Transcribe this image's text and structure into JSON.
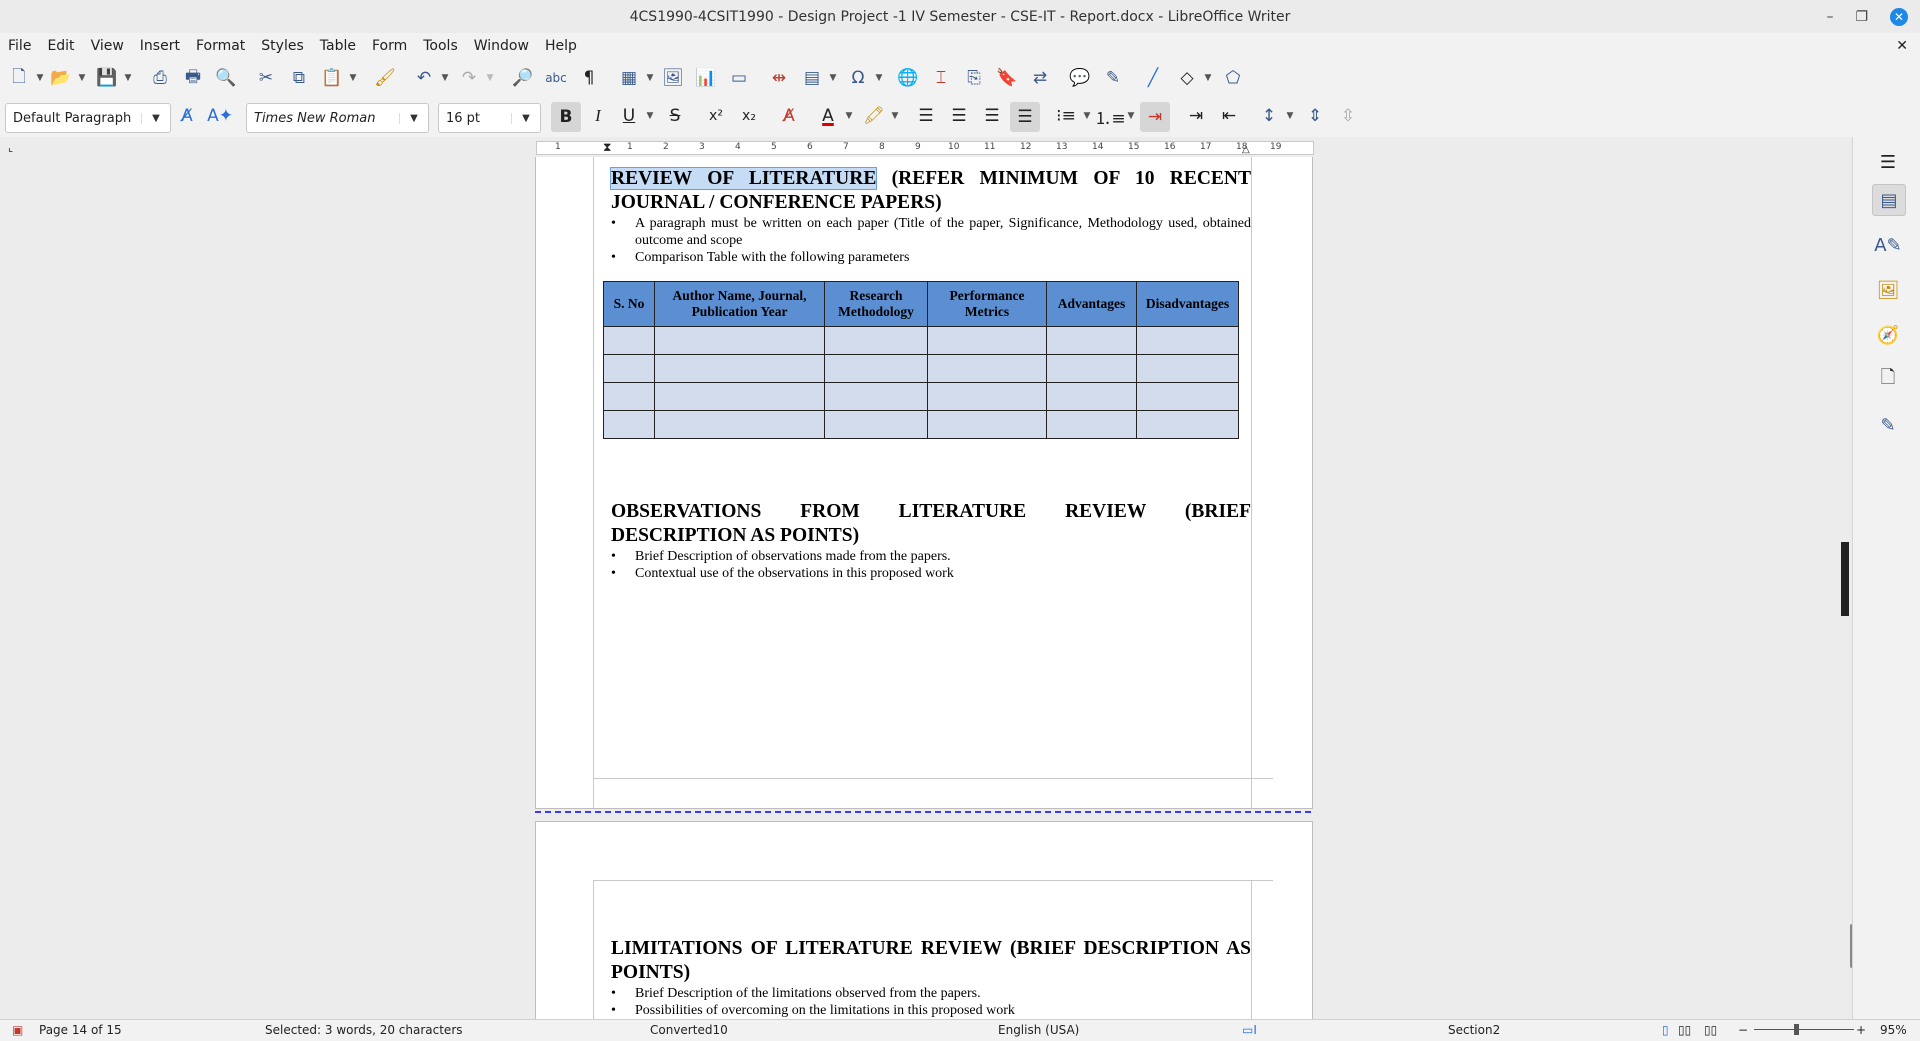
{
  "window": {
    "title": "4CS1990-4CSIT1990 - Design Project -1 IV Semester - CSE-IT - Report.docx - LibreOffice Writer"
  },
  "menu": [
    "File",
    "Edit",
    "View",
    "Insert",
    "Format",
    "Styles",
    "Table",
    "Form",
    "Tools",
    "Window",
    "Help"
  ],
  "formatting": {
    "paragraph_style": "Default Paragraph",
    "font_name": "Times New Roman",
    "font_size": "16 pt"
  },
  "ruler": {
    "numbers": [
      "1",
      "1",
      "2",
      "3",
      "4",
      "5",
      "6",
      "7",
      "8",
      "9",
      "10",
      "11",
      "12",
      "13",
      "14",
      "15",
      "16",
      "17",
      "18",
      "19"
    ]
  },
  "page1": {
    "heading_selected": "REVIEW OF LITERATURE",
    "heading_rest": " (REFER MINIMUM OF 10 RECENT JOURNAL / CONFERENCE PAPERS)",
    "bullets": [
      "A paragraph must be written on each paper (Title of the paper, Significance, Methodology used, obtained outcome and scope",
      "Comparison Table with the following parameters"
    ],
    "table": {
      "headers": [
        "S. No",
        "Author Name, Journal, Publication Year",
        "Research Methodology",
        "Performance Metrics",
        "Advantages",
        "Disadvantages"
      ],
      "empty_rows": 4
    },
    "heading2": "OBSERVATIONS FROM LITERATURE REVIEW (BRIEF DESCRIPTION AS POINTS)",
    "bullets2": [
      "Brief Description of observations made from the papers.",
      "Contextual use of the observations in this proposed work"
    ]
  },
  "page2": {
    "heading": "LIMITATIONS OF LITERATURE REVIEW (BRIEF DESCRIPTION AS POINTS)",
    "bullets": [
      "Brief Description of the limitations observed from the papers.",
      "Possibilities of overcoming on the limitations in this proposed work"
    ]
  },
  "status": {
    "page": "Page 14 of 15",
    "selection": "Selected: 3 words, 20 characters",
    "page_style": "Converted10",
    "language": "English (USA)",
    "section": "Section2",
    "zoom": "95%"
  },
  "colors": {
    "table_header": "#5b8fd2",
    "table_cell": "#d3dcec",
    "selection": "#c5dcf4",
    "page_break": "#3a3aff"
  }
}
